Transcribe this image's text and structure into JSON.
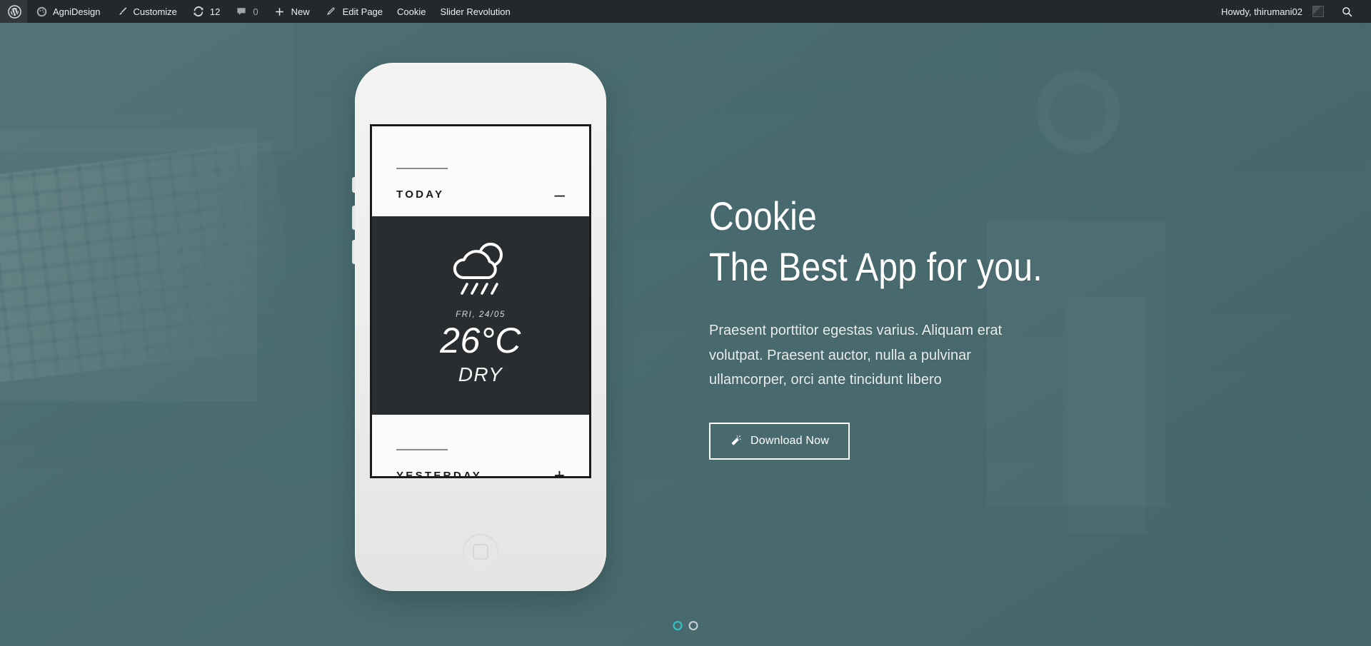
{
  "adminbar": {
    "logo_icon": "wordpress-icon",
    "items": [
      {
        "label": "AgniDesign",
        "icon": "dashboard-icon"
      },
      {
        "label": "Customize",
        "icon": "paintbrush-icon"
      },
      {
        "label": "12",
        "icon": "updates-icon"
      },
      {
        "label": "0",
        "icon": "comment-bubble-icon"
      },
      {
        "label": "New",
        "icon": "plus-icon"
      },
      {
        "label": "Edit Page",
        "icon": "pencil-icon"
      },
      {
        "label": "Cookie",
        "icon": ""
      },
      {
        "label": "Slider Revolution",
        "icon": ""
      }
    ],
    "howdy": "Howdy, thirumani02",
    "search_icon": "search-icon"
  },
  "phone": {
    "weather_app": {
      "today": {
        "title": "TODAY",
        "toggle": "–",
        "toggle_state": "expanded"
      },
      "current": {
        "icon": "rain-cloud-sun-icon",
        "date": "FRI, 24/05",
        "temperature": "26°C",
        "condition": "DRY"
      },
      "yesterday": {
        "title": "YESTERDAY",
        "toggle": "+",
        "toggle_state": "collapsed"
      }
    }
  },
  "hero": {
    "headline1": "Cookie",
    "headline2": "The Best App for you.",
    "paragraph": "Praesent porttitor egestas varius. Aliquam erat volutpat. Praesent auctor, nulla a pulvinar ullamcorper, orci ante tincidunt libero",
    "button": {
      "label": "Download Now",
      "icon": "magic-wand-icon"
    }
  },
  "slider": {
    "bullets": [
      {
        "index": "1",
        "active": true
      },
      {
        "index": "2",
        "active": false
      }
    ]
  },
  "colors": {
    "adminbar_bg": "#23282d",
    "background_teal": "#4e7074",
    "weather_dark": "#2a2d2f",
    "accent_active_bullet": "#2ec7c9",
    "text_white": "#ffffff"
  }
}
